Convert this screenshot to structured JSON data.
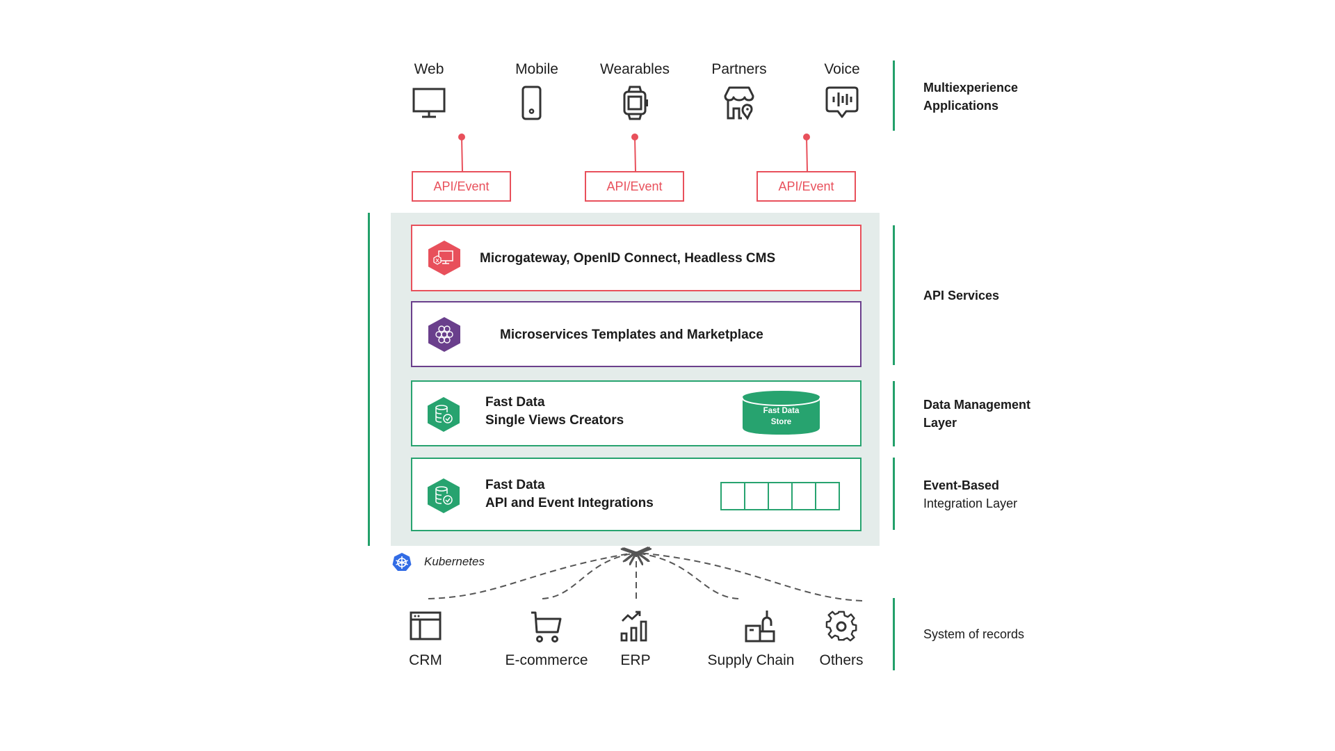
{
  "channels": [
    {
      "label": "Web",
      "icon": "monitor-icon"
    },
    {
      "label": "Mobile",
      "icon": "smartphone-icon"
    },
    {
      "label": "Wearables",
      "icon": "smartwatch-icon"
    },
    {
      "label": "Partners",
      "icon": "storefront-location-icon"
    },
    {
      "label": "Voice",
      "icon": "voice-message-icon"
    }
  ],
  "api_event_boxes": [
    "API/Event",
    "API/Event",
    "API/Event"
  ],
  "layers": [
    {
      "title_lines": [
        "Microgateway, OpenID Connect, Headless CMS"
      ],
      "icon": "gateway-monitor-icon",
      "color": "#e8505b"
    },
    {
      "title_lines": [
        "Microservices Templates and Marketplace"
      ],
      "icon": "honeycomb-icon",
      "color": "#6a3f8c"
    },
    {
      "title_lines": [
        "Fast Data",
        "Single Views Creators"
      ],
      "icon": "database-check-icon",
      "color": "#27a36f",
      "extra": {
        "type": "cylinder",
        "label_lines": [
          "Fast Data",
          "Store"
        ]
      }
    },
    {
      "title_lines": [
        "Fast Data",
        "API and Event Integrations"
      ],
      "icon": "database-check-icon",
      "color": "#27a36f",
      "extra": {
        "type": "queue",
        "cells": 5
      }
    }
  ],
  "platform": {
    "label": "Kubernetes",
    "icon": "kubernetes-icon"
  },
  "side_labels": [
    {
      "lines": [
        "Multiexperience",
        "Applications"
      ]
    },
    {
      "lines": [
        "API Services"
      ]
    },
    {
      "lines": [
        "Data Management",
        "Layer"
      ]
    },
    {
      "lines": [
        "Event-Based",
        "Integration Layer"
      ]
    },
    {
      "lines": [
        "System of records"
      ]
    }
  ],
  "systems_of_record": [
    {
      "label": "CRM",
      "icon": "browser-window-icon"
    },
    {
      "label": "E-commerce",
      "icon": "shopping-cart-icon"
    },
    {
      "label": "ERP",
      "icon": "bar-chart-trend-icon"
    },
    {
      "label": "Supply Chain",
      "icon": "warehouse-crane-icon"
    },
    {
      "label": "Others",
      "icon": "gear-icon"
    }
  ],
  "colors": {
    "api_red": "#e8505b",
    "purple": "#6a3f8c",
    "green": "#27a36f",
    "panel_bg": "#e4ecea",
    "kubernetes_blue": "#326ce5",
    "dash_gray": "#555555"
  }
}
